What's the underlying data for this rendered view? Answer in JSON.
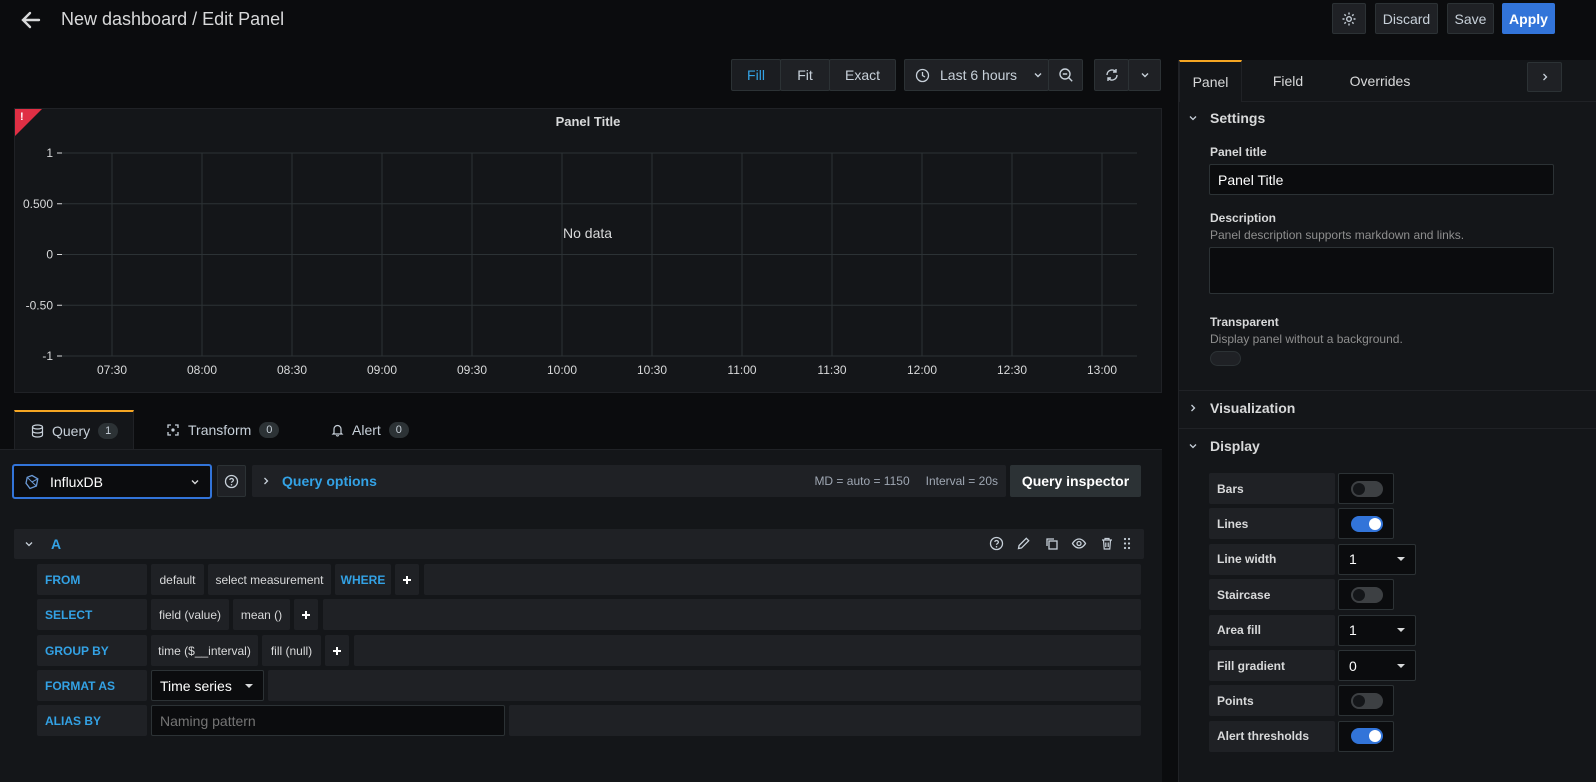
{
  "header": {
    "title": "New dashboard / Edit Panel",
    "discard": "Discard",
    "save": "Save",
    "apply": "Apply"
  },
  "toolbar": {
    "fill": "Fill",
    "fit": "Fit",
    "exact": "Exact",
    "time_range": "Last 6 hours"
  },
  "panel": {
    "title": "Panel Title",
    "no_data": "No data"
  },
  "chart_data": {
    "type": "line",
    "series": [],
    "y_ticks": [
      "1",
      "0.500",
      "0",
      "-0.50",
      "-1"
    ],
    "x_ticks": [
      "07:30",
      "08:00",
      "08:30",
      "09:00",
      "09:30",
      "10:00",
      "10:30",
      "11:00",
      "11:30",
      "12:00",
      "12:30",
      "13:00"
    ],
    "ylim": [
      -1,
      1
    ],
    "grid": true
  },
  "query_tabs": [
    {
      "label": "Query",
      "count": "1"
    },
    {
      "label": "Transform",
      "count": "0"
    },
    {
      "label": "Alert",
      "count": "0"
    }
  ],
  "datasource": {
    "name": "InfluxDB",
    "query_options": "Query options",
    "md": "MD = auto = 1150",
    "interval": "Interval = 20s",
    "inspector": "Query inspector"
  },
  "query": {
    "ref": "A",
    "from_label": "FROM",
    "from_policy": "default",
    "from_measurement": "select measurement",
    "where": "WHERE",
    "select_label": "SELECT",
    "select_field": "field (value)",
    "select_agg": "mean ()",
    "group_label": "GROUP BY",
    "group_time": "time ($__interval)",
    "group_fill": "fill (null)",
    "format_label": "FORMAT AS",
    "format_value": "Time series",
    "alias_label": "ALIAS BY",
    "alias_placeholder": "Naming pattern"
  },
  "side": {
    "tabs": [
      "Panel",
      "Field",
      "Overrides"
    ],
    "settings": "Settings",
    "panel_title_label": "Panel title",
    "panel_title_value": "Panel Title",
    "description_label": "Description",
    "description_hint": "Panel description supports markdown and links.",
    "transparent_label": "Transparent",
    "transparent_hint": "Display panel without a background.",
    "visualization": "Visualization",
    "display": "Display",
    "display_options": [
      {
        "label": "Bars",
        "type": "toggle",
        "on": false
      },
      {
        "label": "Lines",
        "type": "toggle",
        "on": true
      },
      {
        "label": "Line width",
        "type": "select",
        "value": "1"
      },
      {
        "label": "Staircase",
        "type": "toggle",
        "on": false
      },
      {
        "label": "Area fill",
        "type": "select",
        "value": "1"
      },
      {
        "label": "Fill gradient",
        "type": "select",
        "value": "0"
      },
      {
        "label": "Points",
        "type": "toggle",
        "on": false
      },
      {
        "label": "Alert thresholds",
        "type": "toggle",
        "on": true
      }
    ]
  },
  "colors": {
    "accent": "#3274d9",
    "link": "#33a2e5",
    "alert_red": "#e02f44",
    "tab_highlight": "#f5a623"
  }
}
